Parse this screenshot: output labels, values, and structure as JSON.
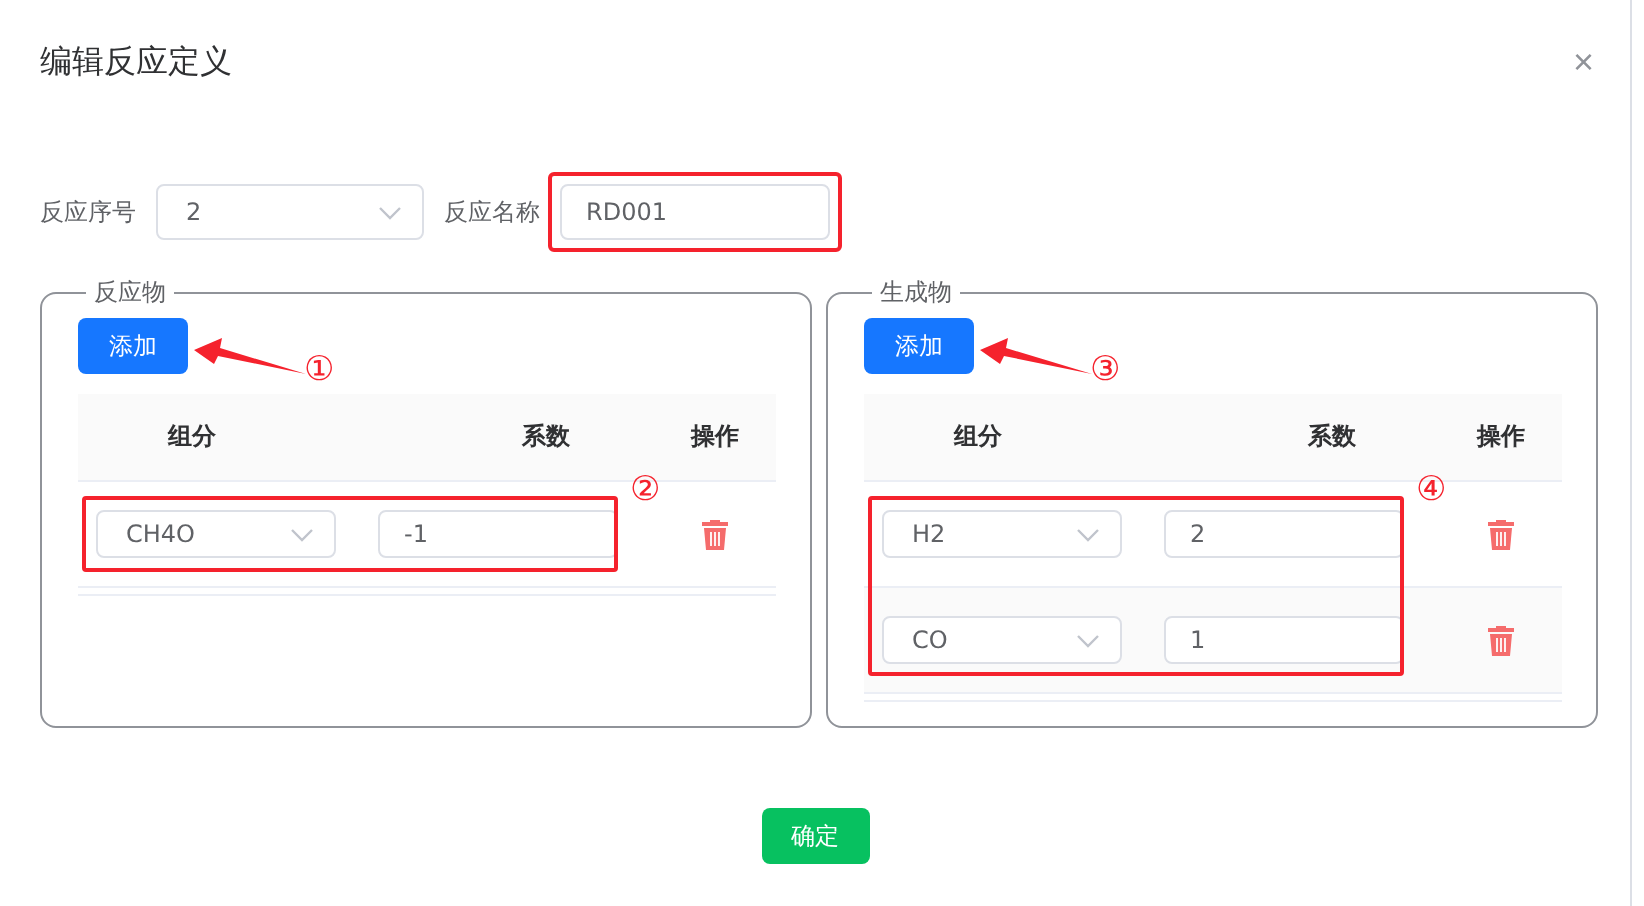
{
  "dialog": {
    "title": "编辑反应定义",
    "close": "×"
  },
  "form": {
    "index_label": "反应序号",
    "index_value": "2",
    "name_label": "反应名称",
    "name_value": "RD001",
    "name_highlighted": true
  },
  "panels": [
    {
      "legend": "反应物",
      "add_button": "添加",
      "add_marker": "①",
      "rows_marker": "②",
      "columns": [
        "组分",
        "系数",
        "操作"
      ],
      "rows": [
        {
          "component": "CH4O",
          "coefficient": "-1"
        }
      ]
    },
    {
      "legend": "生成物",
      "add_button": "添加",
      "add_marker": "③",
      "rows_marker": "④",
      "columns": [
        "组分",
        "系数",
        "操作"
      ],
      "rows": [
        {
          "component": "H2",
          "coefficient": "2"
        },
        {
          "component": "CO",
          "coefficient": "1"
        }
      ]
    }
  ],
  "confirm_button": "确定"
}
